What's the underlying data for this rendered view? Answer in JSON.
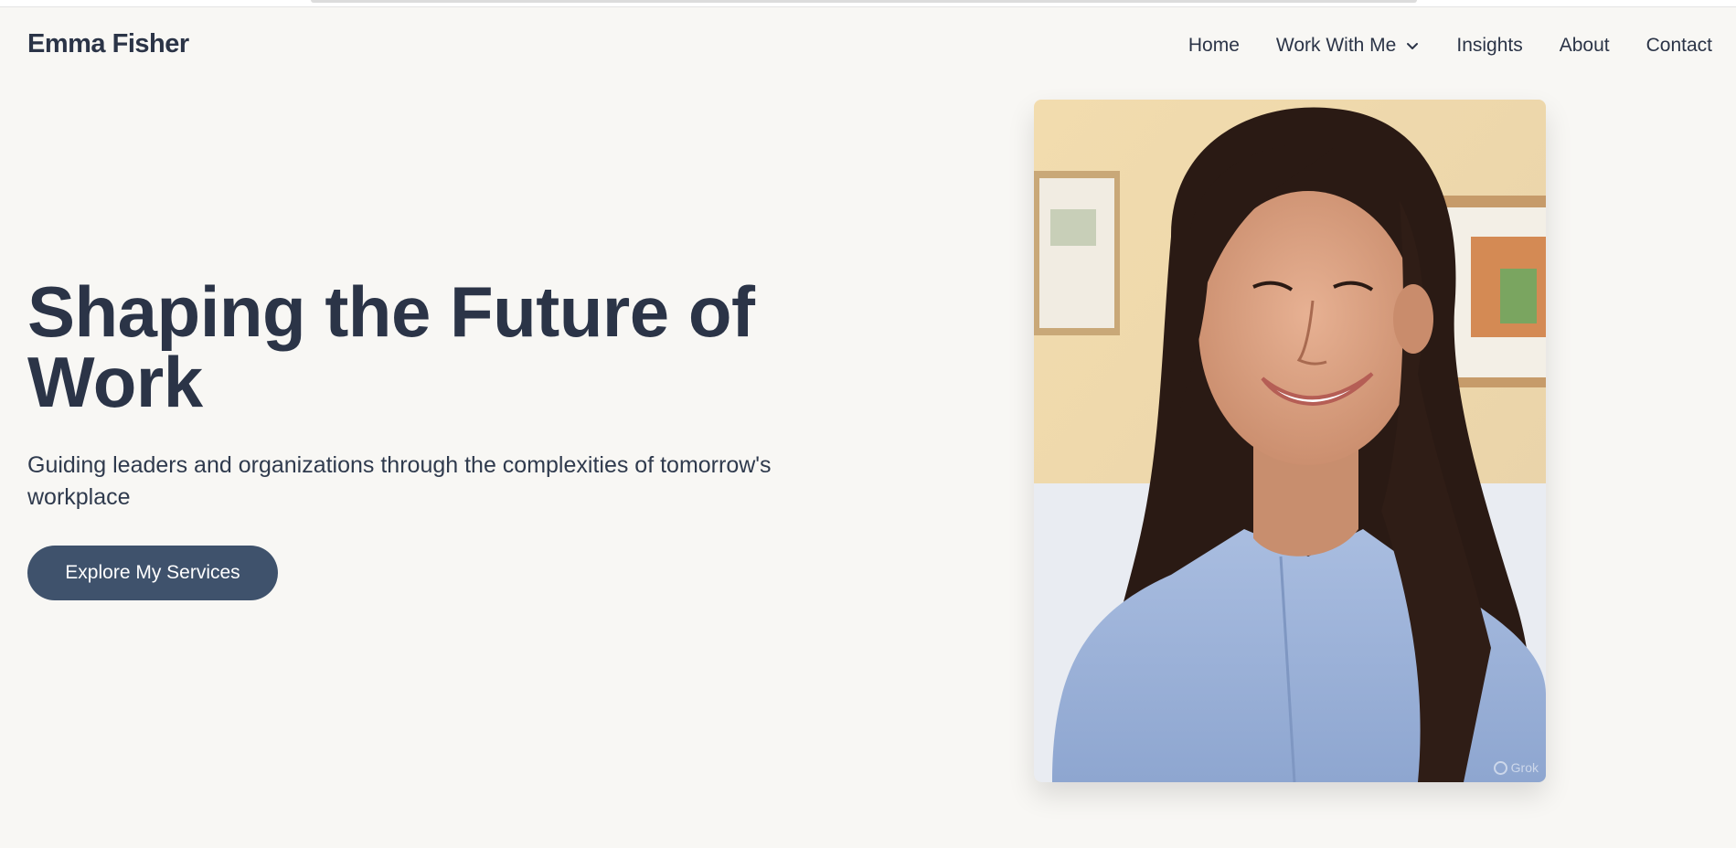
{
  "header": {
    "logo": "Emma Fisher",
    "nav": [
      {
        "label": "Home"
      },
      {
        "label": "Work With Me",
        "icon": "chevron-down-icon"
      },
      {
        "label": "Insights"
      },
      {
        "label": "About"
      },
      {
        "label": "Contact"
      }
    ]
  },
  "hero": {
    "headline_line1": "Shaping the Future of",
    "headline_line2": "Work",
    "subtitle": "Guiding leaders and organizations through the complexities of tomorrow's workplace",
    "cta_label": "Explore My Services"
  },
  "photo": {
    "watermark": "Grok"
  },
  "colors": {
    "background": "#f8f7f4",
    "text": "#2b3447",
    "button": "#3f526c",
    "button_text": "#ffffff"
  }
}
